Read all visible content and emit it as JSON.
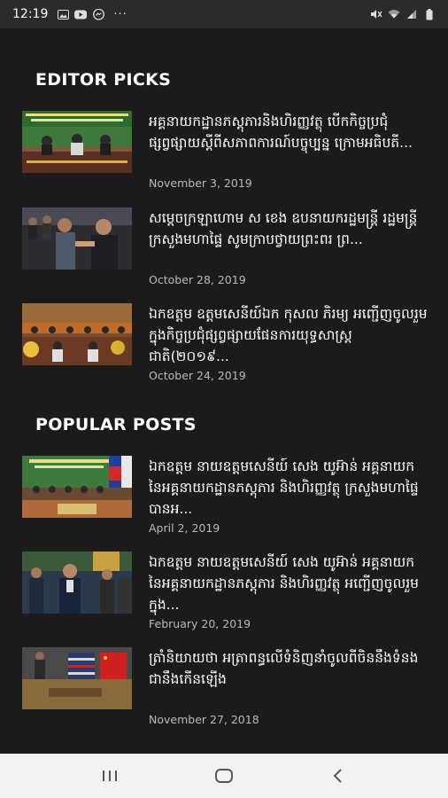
{
  "status_bar": {
    "time": "12:19",
    "more": "···",
    "icons": [
      "gallery-icon",
      "youtube-icon",
      "messenger-icon",
      "mute-icon",
      "wifi-icon",
      "signal-icon",
      "battery-icon"
    ]
  },
  "sections": {
    "editor_picks": {
      "title": "EDITOR PICKS",
      "posts": [
        {
          "title": "អគ្គនាយកដ្ឋានភស្តុភារនិងហិរញ្ញវត្ថុ បើកកិច្ចប្រជុំ ផ្សព្វផ្សាយស្ដីពីសភាពការណ៍បច្ចុប្បន្ន ក្រោមអធិបតី...",
          "date": "November 3, 2019"
        },
        {
          "title": "សម្ដេចក្រឡាហោម ស ខេង ឧបនាយករដ្ឋមន្រ្តី រដ្ឋមន្រ្តីក្រសួងមហាផ្ទៃ សូមក្រាបថ្វាយព្រះពរ ព្រ...",
          "date": "October 28, 2019"
        },
        {
          "title": "ឯកឧត្តម ឧត្តមសេនីយ៍ឯក កុសល ភិរម្យ អញ្ជើញចូលរួមក្នុងកិច្ចប្រជុំផ្សព្វផ្សាយផែនការយុទ្ធសាស្រ្តជាតិ(២០១៩...",
          "date": "October 24, 2019"
        }
      ]
    },
    "popular_posts": {
      "title": "POPULAR POSTS",
      "posts": [
        {
          "title": "ឯកឧត្តម នាយឧត្តមសេនីយ៍ សេង យូអ៊ាន់ អគ្គនាយក នៃអគ្គនាយកដ្ឋានភស្តុភារ និងហិរញ្ញវត្ថុ ក្រសួងមហាផ្ទៃ បានអ...",
          "date": "April 2, 2019"
        },
        {
          "title": "ឯកឧត្តម នាយឧត្តមសេនីយ៍ សេង យូអ៊ាន់ អគ្គនាយក នៃអគ្គនាយកដ្ឋានភស្តុភារ និងហិរញ្ញវត្ថុ អញ្ជើញចូលរួមក្នុង...",
          "date": "February 20, 2019"
        },
        {
          "title": "ត្រាំនិយាយថា អត្រាពន្ធលើទំនិញនាំចូលពីចិននឹងទំនងជានឹងកើនឡើង",
          "date": "November 27, 2018"
        }
      ]
    }
  },
  "nav_bar": {
    "buttons": [
      "recent-apps-icon",
      "home-icon",
      "back-icon"
    ]
  },
  "colors": {
    "background": "#1b1b1b",
    "status_bar": "#2b2b2b",
    "nav_bar": "#f2f2f2",
    "text": "#ffffff",
    "date_text": "#b9b9b9"
  }
}
